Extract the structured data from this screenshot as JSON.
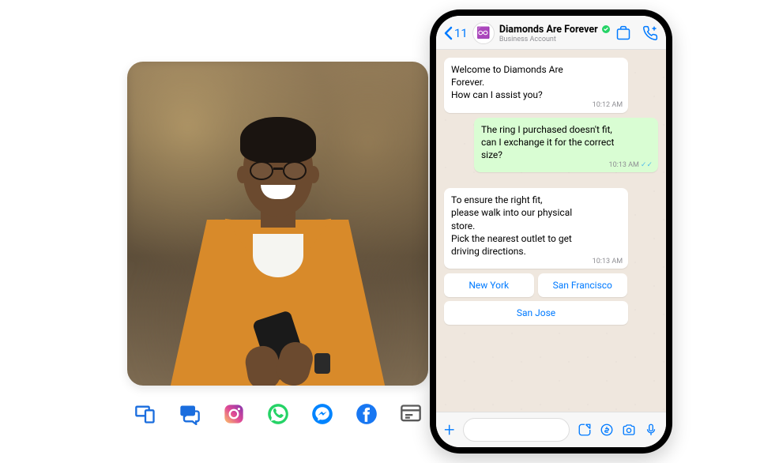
{
  "header": {
    "back_count": "11",
    "business_name": "Diamonds Are Forever",
    "business_subtitle": "Business Account",
    "avatar_emoji": "♾️"
  },
  "messages": {
    "m1_text": "Welcome to Diamonds Are Forever.\nHow can I assist you?",
    "m1_time": "10:12 AM",
    "m2_text": "The ring I purchased doesn't fit, can I exchange it for the correct size?",
    "m2_time": "10:13 AM",
    "m3_text": "To ensure the right fit,\nplease walk into our physical store.\nPick the nearest outlet to get driving directions.",
    "m3_time": "10:13 AM"
  },
  "options": {
    "opt1": "New York",
    "opt2": "San Francisco",
    "opt3": "San Jose"
  },
  "icons": {
    "devices": "devices",
    "chat": "chat",
    "instagram": "instagram",
    "whatsapp": "whatsapp",
    "messenger": "messenger",
    "facebook": "facebook",
    "webchat": "webchat"
  }
}
